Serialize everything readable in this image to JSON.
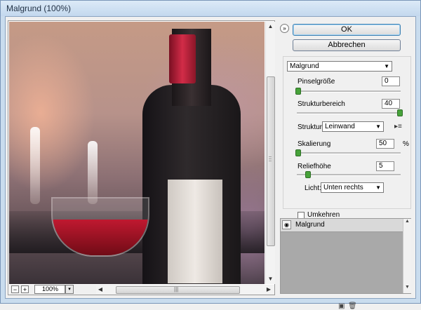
{
  "window": {
    "title": "Malgrund (100%)"
  },
  "preview": {
    "zoom_value": "100%",
    "zoom_out_label": "−",
    "zoom_in_label": "+",
    "zoom_dropdown_label": "▾"
  },
  "buttons": {
    "collapse_label": "»",
    "ok_label": "OK",
    "cancel_label": "Abbrechen"
  },
  "filter": {
    "selected": "Malgrund",
    "params": {
      "brush_size": {
        "label": "Pinselgröße",
        "value": "0",
        "level": 0
      },
      "texture_coverage": {
        "label": "Strukturbereich",
        "value": "40",
        "level": 1.0
      },
      "texture": {
        "label": "Struktur:",
        "selected": "Leinwand"
      },
      "scaling": {
        "label": "Skalierung",
        "value": "50",
        "unit": "%",
        "level": 0
      },
      "relief": {
        "label": "Reliefhöhe",
        "value": "5",
        "level": 0.1
      },
      "light": {
        "label": "Licht:",
        "selected": "Unten rechts"
      },
      "invert": {
        "label": "Umkehren",
        "checked": false
      }
    }
  },
  "layers": {
    "items": [
      {
        "name": "Malgrund",
        "visible": true
      }
    ]
  }
}
